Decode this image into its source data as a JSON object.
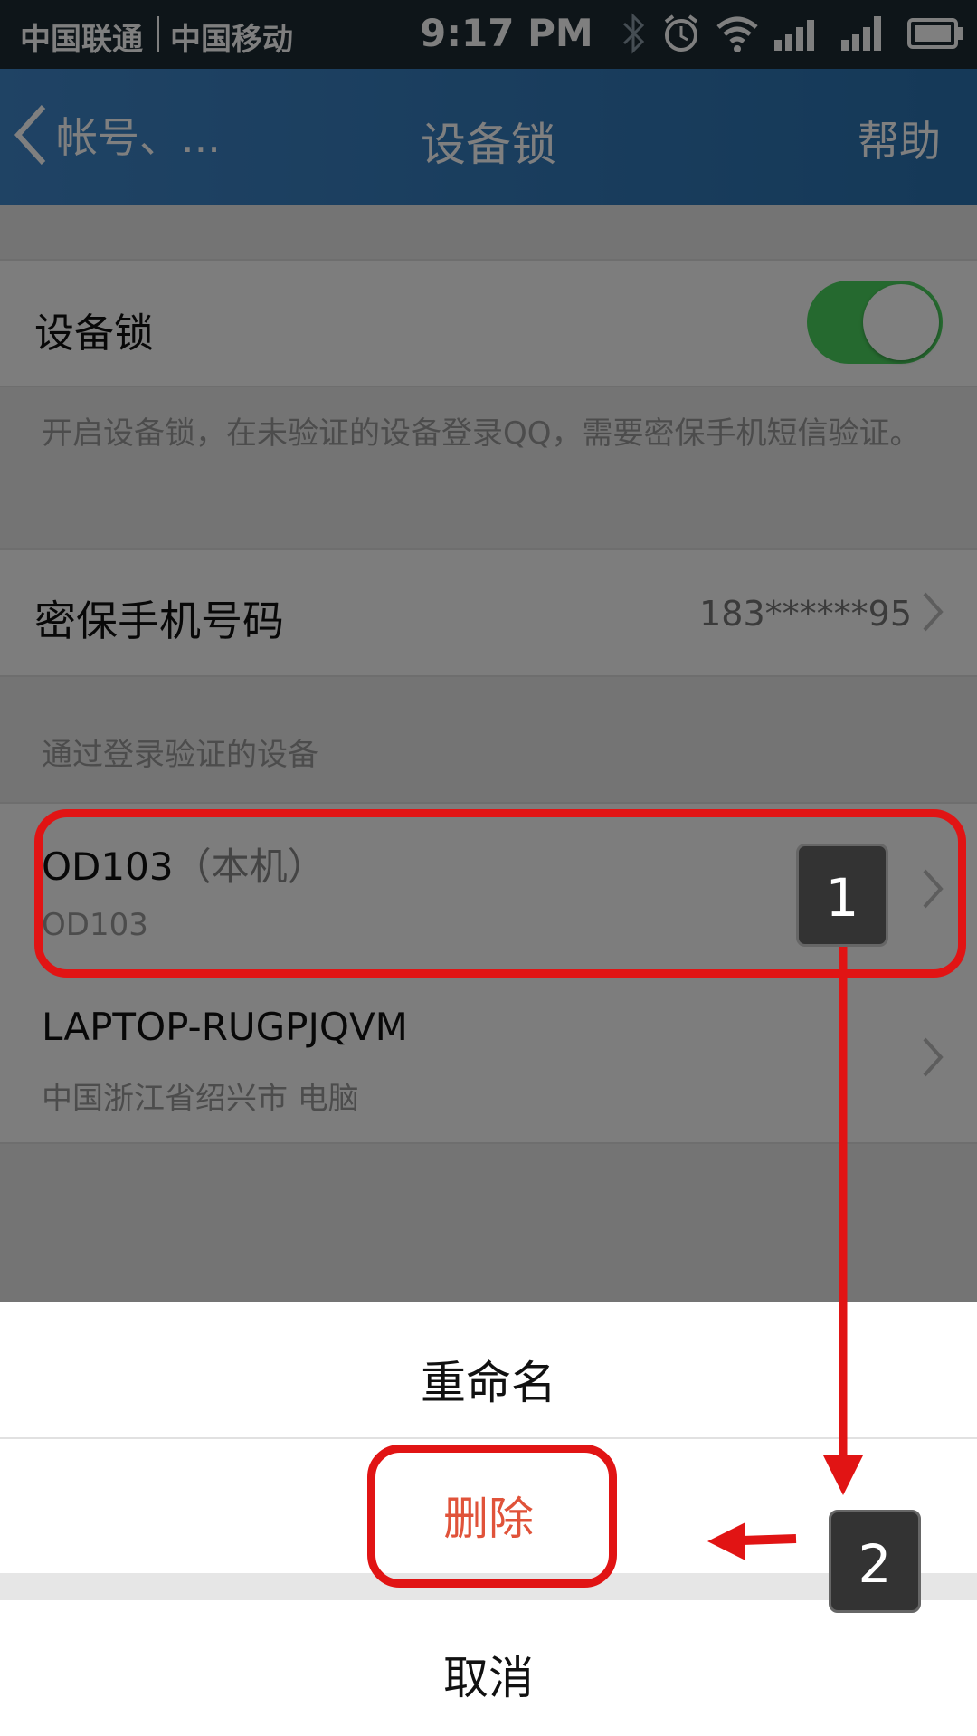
{
  "status_bar": {
    "carrier1": "中国联通",
    "carrier2": "中国移动",
    "time": "9:17 PM",
    "icons": [
      "bluetooth-icon",
      "alarm-icon",
      "wifi-icon",
      "signal-sim2-icon",
      "signal-sim1-icon",
      "battery-icon"
    ]
  },
  "nav": {
    "back_label": "帐号、...",
    "title": "设备锁",
    "help": "帮助"
  },
  "device_lock": {
    "label": "设备锁",
    "toggle_on": true,
    "description": "开启设备锁，在未验证的设备登录QQ，需要密保手机短信验证。"
  },
  "phone": {
    "label": "密保手机号码",
    "value": "183******95"
  },
  "devices": {
    "header": "通过登录验证的设备",
    "items": [
      {
        "name": "OD103",
        "tag": "（本机）",
        "sub": "OD103"
      },
      {
        "name": "LAPTOP-RUGPJQVM",
        "tag": "",
        "sub": "中国浙江省绍兴市 电脑"
      }
    ]
  },
  "sheet": {
    "rename": "重命名",
    "delete": "删除",
    "cancel": "取消"
  },
  "annotations": {
    "step1": "1",
    "step2": "2",
    "color": "#e11414"
  },
  "colors": {
    "toggle": "#4bd25e",
    "nav": "#3f86c9",
    "delete": "#e0533a"
  }
}
